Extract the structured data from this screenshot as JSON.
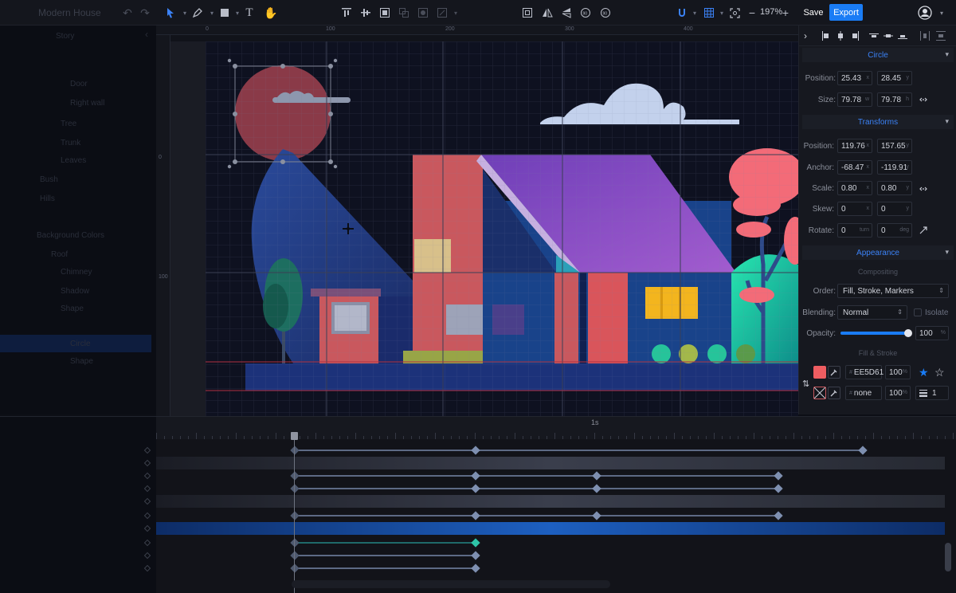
{
  "document": {
    "title": "Modern House"
  },
  "toolbar": {
    "zoom": "197%",
    "zoom_minus": "−",
    "zoom_plus": "+",
    "save_label": "Save",
    "export_label": "Export"
  },
  "layers": {
    "items": [
      {
        "label": "Story"
      },
      {
        "label": ""
      },
      {
        "label": "Door"
      },
      {
        "label": "Right wall"
      },
      {
        "label": "Tree"
      },
      {
        "label": "Trunk"
      },
      {
        "label": "Leaves"
      },
      {
        "label": "Bush"
      },
      {
        "label": "Hills"
      },
      {
        "label": "Background Colors"
      },
      {
        "label": "Roof"
      },
      {
        "label": "Chimney"
      },
      {
        "label": "Shadow"
      },
      {
        "label": "Shape"
      },
      {
        "label": "Circle"
      },
      {
        "label": "Shape"
      }
    ]
  },
  "rulers": {
    "top": [
      "0",
      "100",
      "200",
      "300",
      "400"
    ],
    "left": [
      "0",
      "100"
    ]
  },
  "panel": {
    "circle": {
      "title": "Circle",
      "position_label": "Position:",
      "pos_x": "25.43",
      "pos_y": "28.45",
      "size_label": "Size:",
      "w": "79.78",
      "h": "79.78",
      "unit_x": "x",
      "unit_y": "y",
      "unit_w": "w",
      "unit_h": "h"
    },
    "transforms": {
      "title": "Transforms",
      "position_label": "Position:",
      "pos_x": "119.76",
      "pos_y": "157.65",
      "anchor_label": "Anchor:",
      "anc_x": "-68.47",
      "anc_y": "-119.91",
      "scale_label": "Scale:",
      "scale_x": "0.80",
      "scale_y": "0.80",
      "skew_label": "Skew:",
      "skew_x": "0",
      "skew_y": "0",
      "rotate_label": "Rotate:",
      "rot_turn": "0",
      "rot_deg": "0",
      "unit_turn": "turn",
      "unit_deg": "deg"
    },
    "appearance": {
      "title": "Appearance",
      "compositing": "Compositing",
      "order_label": "Order:",
      "order_value": "Fill, Stroke, Markers",
      "blending_label": "Blending:",
      "blending_value": "Normal",
      "isolate_label": "Isolate",
      "opacity_label": "Opacity:",
      "opacity_value": "100",
      "opacity_unit": "%",
      "opacity_level": 1.0
    },
    "fill_stroke": {
      "title": "Fill & Stroke",
      "fill_hex": "EE5D61",
      "fill_opacity": "100",
      "stroke_hex": "none",
      "stroke_opacity": "100",
      "stroke_width": "1",
      "hash": "#",
      "pct": "%"
    }
  },
  "timeline": {
    "marker_1s": "1s"
  },
  "colors": {
    "accent": "#1a7cf5",
    "fill": "#EE5D61"
  }
}
